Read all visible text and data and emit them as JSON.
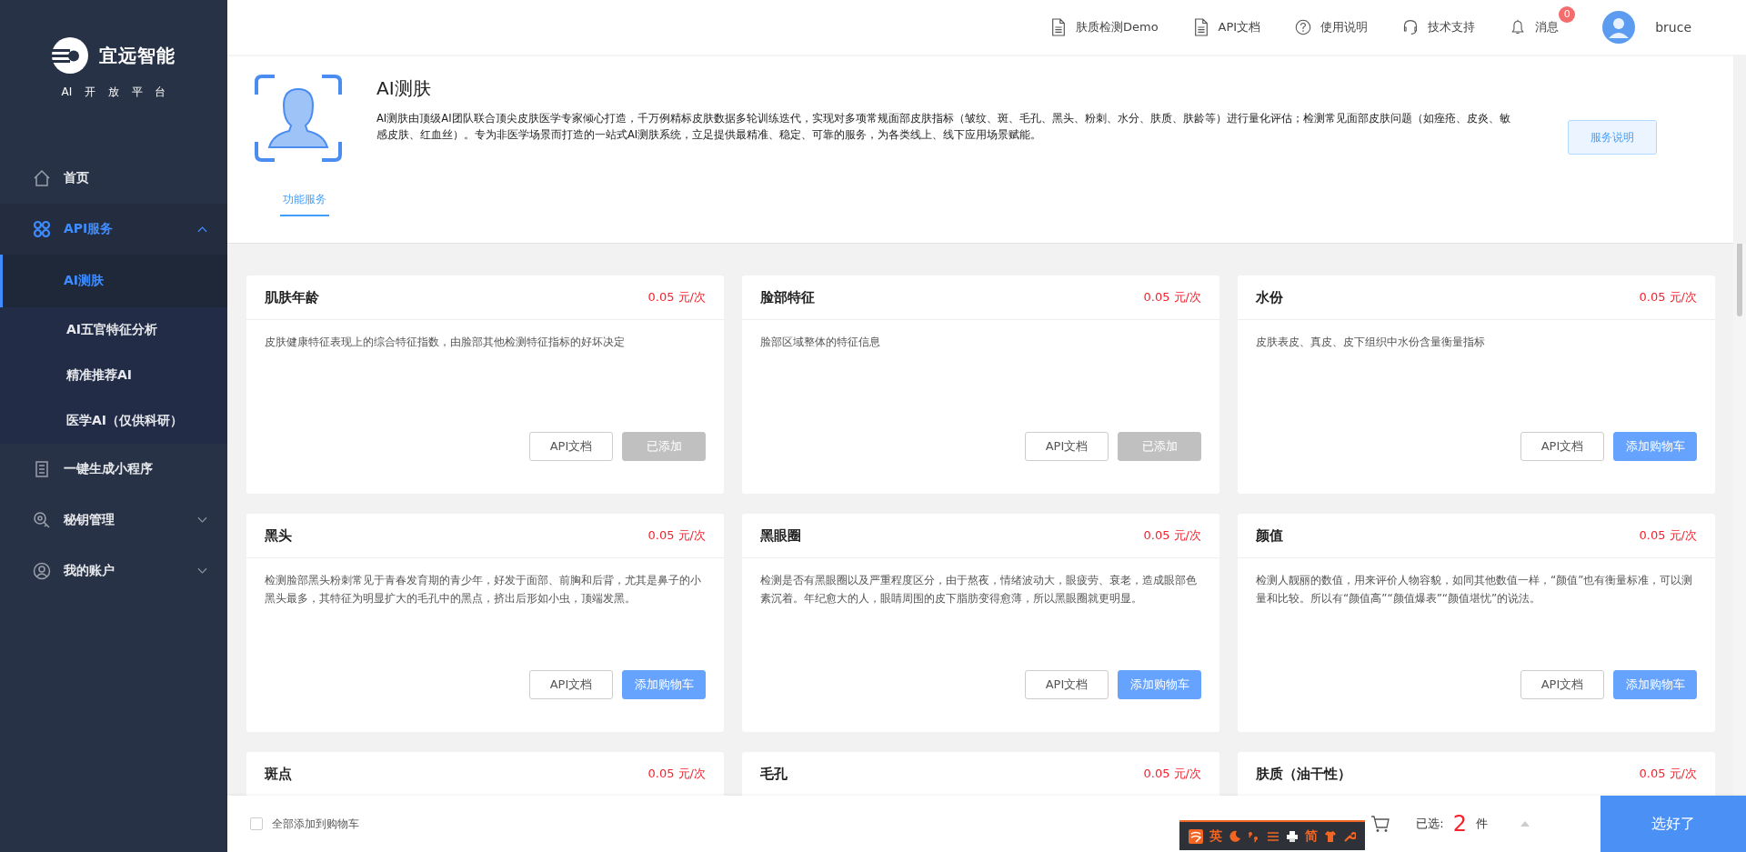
{
  "sidebar": {
    "brand": "宜远智能",
    "subtitle": "AI 开 放 平 台",
    "items": [
      {
        "label": "首页",
        "selected": false
      },
      {
        "label": "API服务",
        "selected": true,
        "expanded": true,
        "children": [
          {
            "label": "AI测肤",
            "selected": true
          },
          {
            "label": "AI五官特征分析",
            "selected": false
          },
          {
            "label": "精准推荐AI",
            "selected": false
          },
          {
            "label": "医学AI（仅供科研）",
            "selected": false
          }
        ]
      },
      {
        "label": "一键生成小程序",
        "selected": false
      },
      {
        "label": "秘钥管理",
        "selected": false,
        "expanded": false
      },
      {
        "label": "我的账户",
        "selected": false,
        "expanded": false
      }
    ]
  },
  "header": {
    "links": [
      "肤质检测Demo",
      "API文档",
      "使用说明",
      "技术支持",
      "消息"
    ],
    "badge": "0",
    "user": "bruce"
  },
  "intro": {
    "title": "AI测肤",
    "description": "AI测肤由顶级AI团队联合顶尖皮肤医学专家倾心打造，千万例精标皮肤数据多轮训练迭代，实现对多项常规面部皮肤指标（皱纹、斑、毛孔、黑头、粉刺、水分、肤质、肤龄等）进行量化评估；检测常见面部皮肤问题（如痤疮、皮炎、敏感皮肤、红血丝）。专为非医学场景而打造的一站式AI测肤系统，立足提供最精准、稳定、可靠的服务，为各类线上、线下应用场景赋能。",
    "button": "服务说明",
    "tabs": [
      {
        "label": "功能服务",
        "selected": true
      }
    ]
  },
  "cards": [
    {
      "title": "肌肤年龄",
      "price": "0.05 元/次",
      "description": "皮肤健康特征表现上的综合特征指数，由脸部其他检测特征指标的好坏决定",
      "doc": "API文档",
      "action": {
        "label": "已添加",
        "added": true
      }
    },
    {
      "title": "脸部特征",
      "price": "0.05 元/次",
      "description": "脸部区域整体的特征信息",
      "doc": "API文档",
      "action": {
        "label": "已添加",
        "added": true
      }
    },
    {
      "title": "水份",
      "price": "0.05 元/次",
      "description": "皮肤表皮、真皮、皮下组织中水份含量衡量指标",
      "doc": "API文档",
      "action": {
        "label": "添加购物车",
        "added": false
      }
    },
    {
      "title": "黑头",
      "price": "0.05 元/次",
      "description": "检测脸部黑头粉刺常见于青春发育期的青少年，好发于面部、前胸和后背，尤其是鼻子的小黑头最多，其特征为明显扩大的毛孔中的黑点，挤出后形如小虫，顶端发黑。",
      "doc": "API文档",
      "action": {
        "label": "添加购物车",
        "added": false
      }
    },
    {
      "title": "黑眼圈",
      "price": "0.05 元/次",
      "description": "检测是否有黑眼圈以及严重程度区分，由于熬夜，情绪波动大，眼疲劳、衰老，造成眼部色素沉着。年纪愈大的人，眼睛周围的皮下脂肪变得愈薄，所以黑眼圈就更明显。",
      "doc": "API文档",
      "action": {
        "label": "添加购物车",
        "added": false
      }
    },
    {
      "title": "颜值",
      "price": "0.05 元/次",
      "description": "检测人靓丽的数值，用来评价人物容貌，如同其他数值一样，“颜值”也有衡量标准，可以测量和比较。所以有“颜值高”“颜值爆表”“颜值堪忧”的说法。",
      "doc": "API文档",
      "action": {
        "label": "添加购物车",
        "added": false
      }
    },
    {
      "title": "斑点",
      "price": "0.05 元/次"
    },
    {
      "title": "毛孔",
      "price": "0.05 元/次"
    },
    {
      "title": "肤质（油干性）",
      "price": "0.05 元/次"
    }
  ],
  "footer": {
    "select_all": {
      "label": "全部添加到购物车",
      "checked": false
    },
    "selected_label": "已选:",
    "count": "2",
    "unit": "件",
    "submit": "选好了"
  },
  "ime_toolbar": {
    "items": [
      "英",
      "简"
    ]
  }
}
